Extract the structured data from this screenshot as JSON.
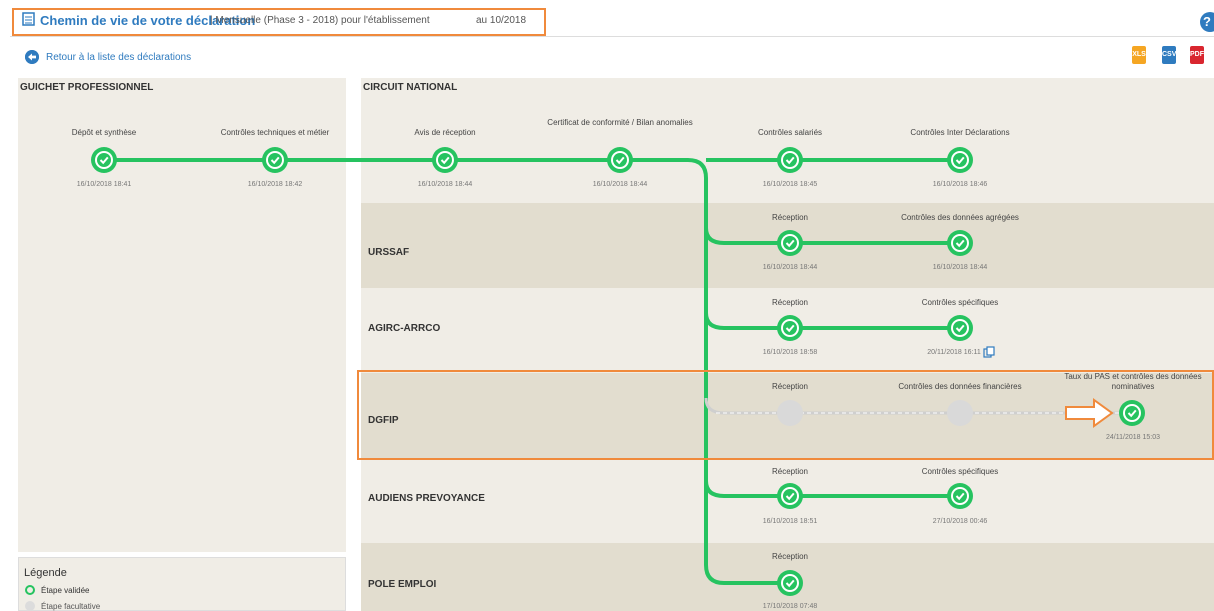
{
  "header": {
    "title": "Chemin de vie de votre déclaration",
    "subtitle": "| Mensuelle (Phase 3 - 2018) pour l'établissement",
    "period": "au 10/2018",
    "back_link": "Retour à la liste des déclarations",
    "help_label": "?"
  },
  "export_icons": [
    "excel-export-icon",
    "csv-export-icon",
    "pdf-export-icon"
  ],
  "colors": {
    "validated": "#26c360",
    "optional": "#d9d9d9",
    "accent": "#2f7bbf",
    "highlight": "#f08a3c"
  },
  "guichet": {
    "title": "GUICHET PROFESSIONNEL",
    "steps": [
      {
        "label": "Dépôt et synthèse",
        "date": "16/10/2018 18:41",
        "status": "validated"
      },
      {
        "label": "Contrôles techniques et métier",
        "date": "16/10/2018 18:42",
        "status": "validated"
      }
    ]
  },
  "national": {
    "title": "CIRCUIT NATIONAL",
    "steps": [
      {
        "label": "Avis de réception",
        "date": "16/10/2018 18:44",
        "status": "validated"
      },
      {
        "label": "Certificat de conformité / Bilan anomalies",
        "date": "16/10/2018 18:44",
        "status": "validated"
      },
      {
        "label": "Contrôles salariés",
        "date": "16/10/2018 18:45",
        "status": "validated"
      },
      {
        "label": "Contrôles Inter Déclarations",
        "date": "16/10/2018 18:46",
        "status": "validated"
      }
    ]
  },
  "organisms": [
    {
      "name": "URSSAF",
      "steps": [
        {
          "label": "Réception",
          "date": "16/10/2018 18:44",
          "status": "validated"
        },
        {
          "label": "Contrôles des données agrégées",
          "date": "16/10/2018 18:44",
          "status": "validated"
        }
      ]
    },
    {
      "name": "AGIRC-ARRCO",
      "steps": [
        {
          "label": "Réception",
          "date": "16/10/2018 18:58",
          "status": "validated"
        },
        {
          "label": "Contrôles spécifiques",
          "date": "20/11/2018 16:11",
          "status": "validated"
        }
      ]
    },
    {
      "name": "DGFIP",
      "steps": [
        {
          "label": "Réception",
          "date": "",
          "status": "optional"
        },
        {
          "label": "Contrôles des données financières",
          "date": "",
          "status": "optional"
        },
        {
          "label": "Taux du PAS et contrôles des données nominatives",
          "date": "24/11/2018 15:03",
          "status": "validated"
        }
      ]
    },
    {
      "name": "AUDIENS PREVOYANCE",
      "steps": [
        {
          "label": "Réception",
          "date": "16/10/2018 18:51",
          "status": "validated"
        },
        {
          "label": "Contrôles spécifiques",
          "date": "27/10/2018 00:46",
          "status": "validated"
        }
      ]
    },
    {
      "name": "POLE EMPLOI",
      "steps": [
        {
          "label": "Réception",
          "date": "17/10/2018 07:48",
          "status": "validated"
        }
      ]
    }
  ],
  "legend": {
    "title": "Légende",
    "items": [
      "Étape validée",
      "Étape facultative"
    ]
  }
}
